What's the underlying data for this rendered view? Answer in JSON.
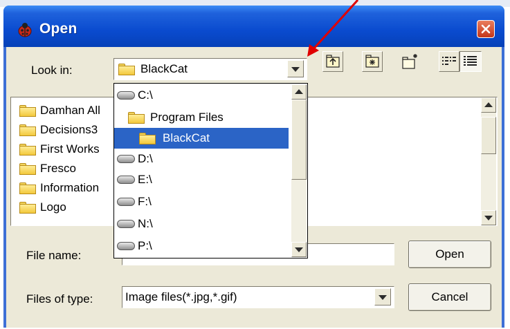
{
  "window": {
    "title": "Open"
  },
  "look_in": {
    "label": "Look in:",
    "value": "BlackCat"
  },
  "files": [
    "Damhan All",
    "Decisions3",
    "First Works",
    "Fresco",
    "Information",
    "Logo"
  ],
  "dropdown": {
    "items": [
      {
        "name": "C:\\",
        "type": "drive",
        "level": 0
      },
      {
        "name": "Program Files",
        "type": "folder",
        "level": 1
      },
      {
        "name": "BlackCat",
        "type": "folder",
        "level": 2,
        "selected": true
      },
      {
        "name": "D:\\",
        "type": "drive",
        "level": 0
      },
      {
        "name": "E:\\",
        "type": "drive",
        "level": 0
      },
      {
        "name": "F:\\",
        "type": "drive",
        "level": 0
      },
      {
        "name": "N:\\",
        "type": "drive",
        "level": 0
      },
      {
        "name": "P:\\",
        "type": "drive",
        "level": 0
      }
    ]
  },
  "file_name": {
    "label": "File name:",
    "value": ""
  },
  "file_type": {
    "label": "Files of type:",
    "value": "Image files(*.jpg,*.gif)"
  },
  "buttons": {
    "open": "Open",
    "cancel": "Cancel"
  },
  "icons": {
    "app": "ladybug-icon",
    "close": "close-icon",
    "up": "up-folder-icon",
    "home": "home-folder-icon",
    "new_folder": "new-folder-icon",
    "list": "list-view-icon",
    "details": "details-view-icon"
  },
  "colors": {
    "titlebar": "#0a4bcf",
    "selection": "#2b64c6",
    "annotation_arrow": "#e00000",
    "dialog_face": "#ece9d8"
  }
}
